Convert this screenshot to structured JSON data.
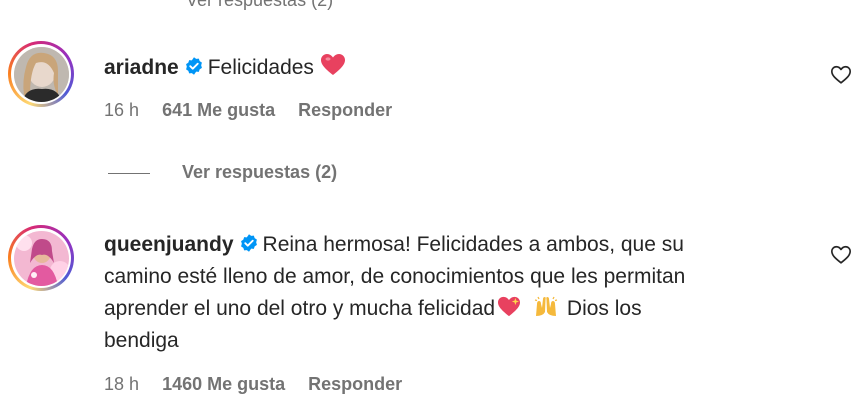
{
  "cut_top_text": "Ver respuestas (2)",
  "comments": [
    {
      "username": "ariadne",
      "text": "Felicidades",
      "emoji": "heart-emoji",
      "time": "16 h",
      "likes": "641 Me gusta",
      "reply": "Responder",
      "view_replies": "Ver respuestas (2)"
    },
    {
      "username": "queenjuandy",
      "text_line1": "Reina hermosa! Felicidades a ambos, que su",
      "text_line2": "camino esté lleno de amor, de conocimientos que les permitan",
      "text_line3_a": "aprender el uno del otro y mucha felicidad",
      "text_line3_b": "Dios los",
      "text_line4": "bendiga",
      "emojis": [
        "sparkling-heart-emoji",
        "raising-hands-emoji"
      ],
      "time": "18 h",
      "likes": "1460 Me gusta",
      "reply": "Responder"
    }
  ],
  "colors": {
    "text": "#262626",
    "secondary": "#737373",
    "verified": "#0095f6",
    "heart": "#ed4956"
  }
}
